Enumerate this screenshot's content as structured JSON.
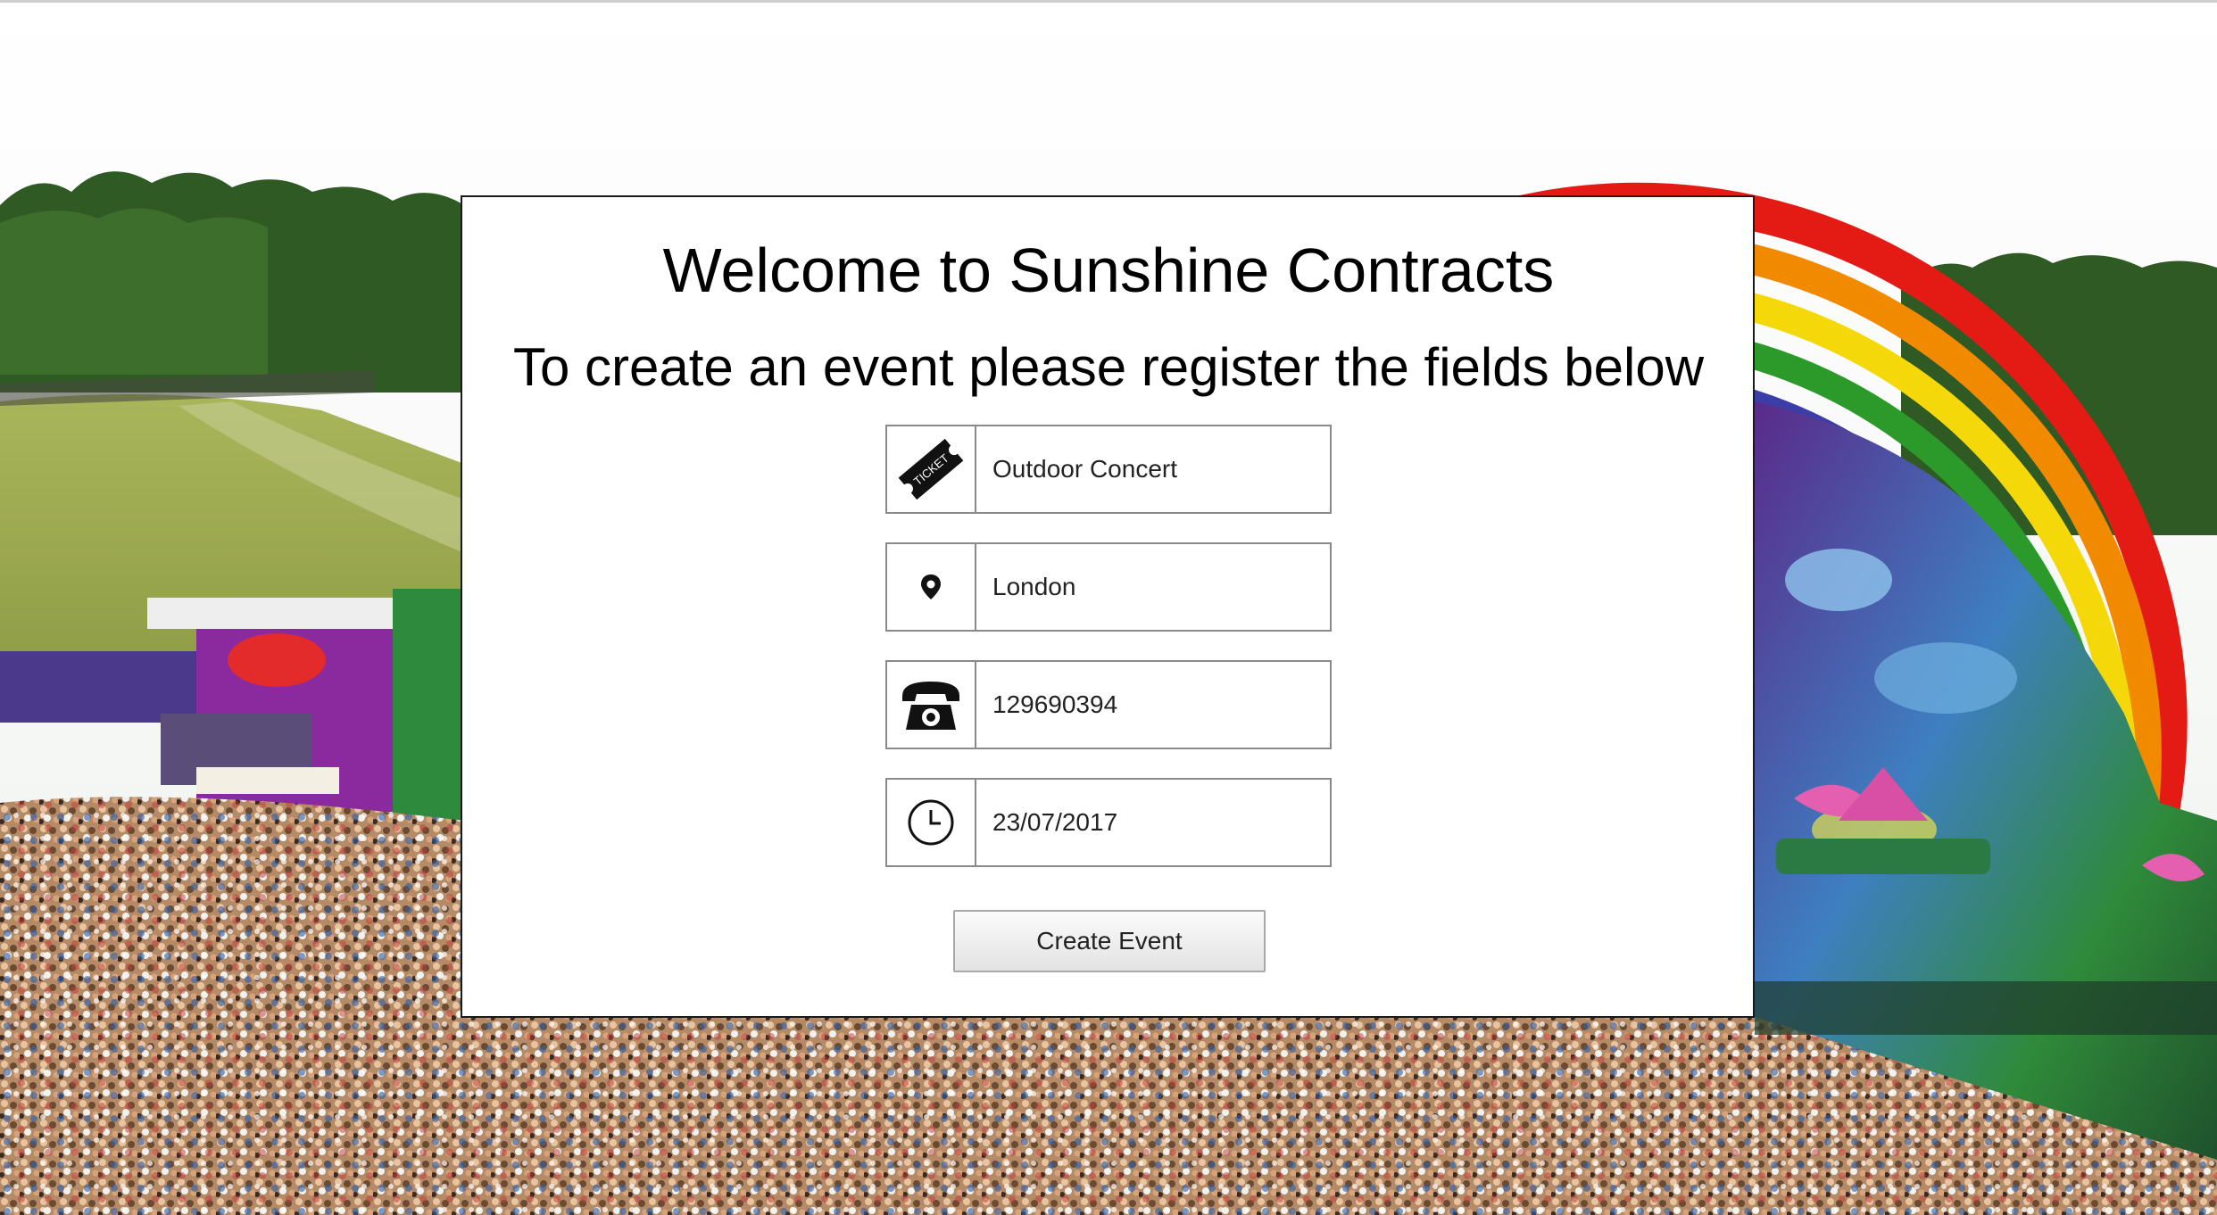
{
  "header": {
    "title": "Welcome to Sunshine Contracts",
    "subtitle": "To create an event please register the fields below"
  },
  "form": {
    "fields": [
      {
        "icon": "ticket-icon",
        "icon_text": "TICKET",
        "value": "Outdoor Concert"
      },
      {
        "icon": "location-pin-icon",
        "value": "London"
      },
      {
        "icon": "telephone-icon",
        "value": "129690394"
      },
      {
        "icon": "clock-icon",
        "value": "23/07/2017"
      }
    ],
    "submit_label": "Create Event"
  },
  "colors": {
    "card_border": "#1a1a1a",
    "field_border": "#8a8a8a",
    "rainbow": [
      "#e31b14",
      "#f28a00",
      "#f5d80a",
      "#2c9a2a",
      "#3b3ea6",
      "#6a2c95"
    ]
  }
}
